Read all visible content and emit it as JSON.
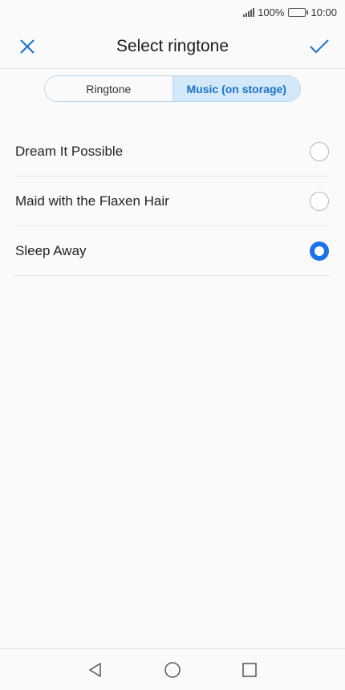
{
  "status_bar": {
    "battery_percent": "100%",
    "time": "10:00"
  },
  "header": {
    "title": "Select ringtone",
    "close_icon": "close-icon",
    "confirm_icon": "check-icon",
    "accent_color": "#1a73c8"
  },
  "tabs": [
    {
      "label": "Ringtone",
      "active": false
    },
    {
      "label": "Music (on storage)",
      "active": true
    }
  ],
  "ringtones": [
    {
      "label": "Dream It Possible",
      "selected": false
    },
    {
      "label": "Maid with the Flaxen Hair",
      "selected": false
    },
    {
      "label": "Sleep Away",
      "selected": true
    }
  ],
  "nav_bar": {
    "back_icon": "back-triangle-icon",
    "home_icon": "home-circle-icon",
    "recents_icon": "recents-square-icon"
  }
}
